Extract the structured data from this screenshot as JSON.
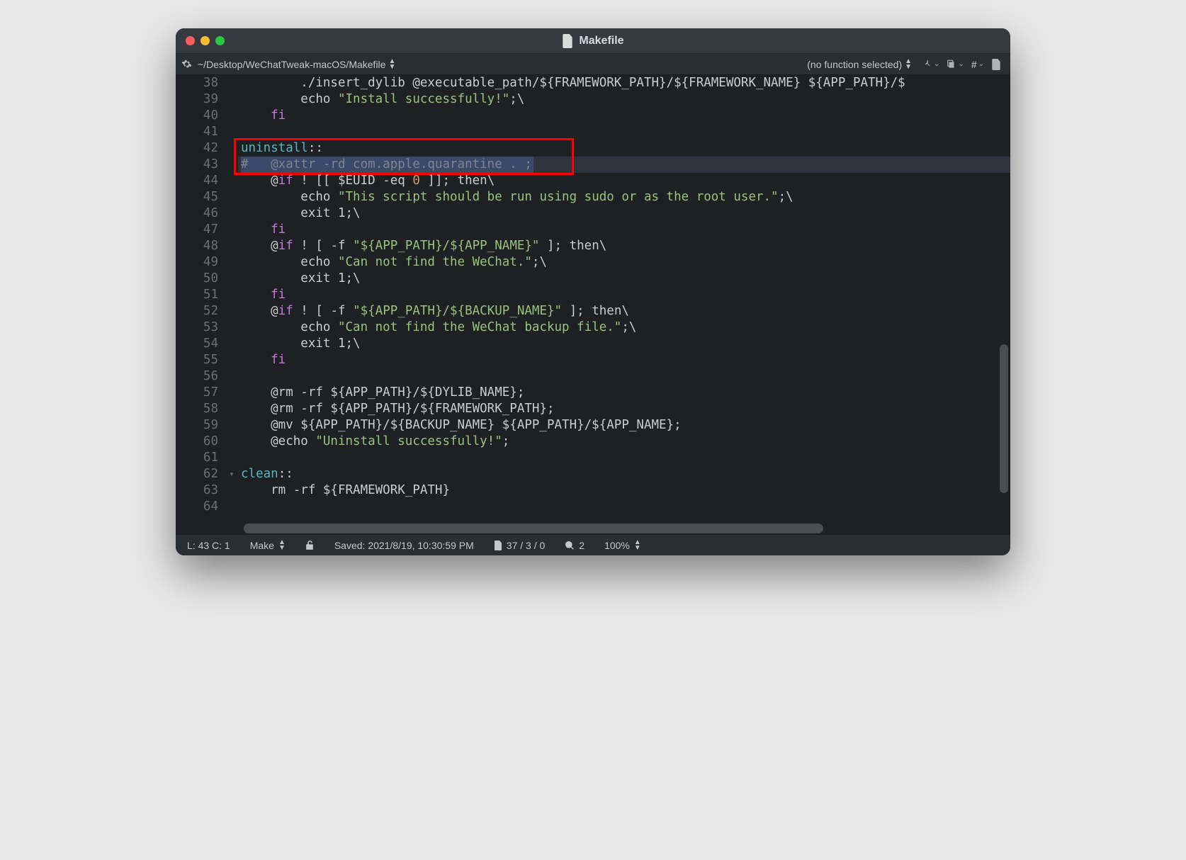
{
  "window": {
    "title": "Makefile"
  },
  "toolbar": {
    "path": "~/Desktop/WeChatTweak-macOS/Makefile",
    "func": "(no function selected)"
  },
  "gutter": {
    "start": 38,
    "end": 64,
    "fold_at": 62
  },
  "code": {
    "lines": [
      {
        "n": 38,
        "segs": [
          {
            "c": "k-text",
            "t": "        ./insert_dylib @executable_path/${FRAMEWORK_PATH}/${FRAMEWORK_NAME} ${APP_PATH}/$"
          }
        ]
      },
      {
        "n": 39,
        "segs": [
          {
            "c": "k-text",
            "t": "        echo "
          },
          {
            "c": "k-str",
            "t": "\"Install successfully!\""
          },
          {
            "c": "k-text",
            "t": ";\\"
          }
        ]
      },
      {
        "n": 40,
        "segs": [
          {
            "c": "k-kw",
            "t": "    fi"
          }
        ]
      },
      {
        "n": 41,
        "segs": []
      },
      {
        "n": 42,
        "segs": [
          {
            "c": "k-target",
            "t": "uninstall"
          },
          {
            "c": "k-text",
            "t": "::"
          }
        ]
      },
      {
        "n": 43,
        "current": true,
        "segs": [
          {
            "c": "k-com",
            "t": "#   @xattr -rd com.apple.quarantine . ;"
          }
        ],
        "selEnd": 39
      },
      {
        "n": 44,
        "segs": [
          {
            "c": "k-text",
            "t": "    @"
          },
          {
            "c": "k-kw",
            "t": "if"
          },
          {
            "c": "k-text",
            "t": " ! [[ $EUID -eq "
          },
          {
            "c": "k-num",
            "t": "0"
          },
          {
            "c": "k-text",
            "t": " ]]; then\\"
          }
        ]
      },
      {
        "n": 45,
        "segs": [
          {
            "c": "k-text",
            "t": "        echo "
          },
          {
            "c": "k-str",
            "t": "\"This script should be run using sudo or as the root user.\""
          },
          {
            "c": "k-text",
            "t": ";\\"
          }
        ]
      },
      {
        "n": 46,
        "segs": [
          {
            "c": "k-text",
            "t": "        exit 1;\\"
          }
        ]
      },
      {
        "n": 47,
        "segs": [
          {
            "c": "k-kw",
            "t": "    fi"
          }
        ]
      },
      {
        "n": 48,
        "segs": [
          {
            "c": "k-text",
            "t": "    @"
          },
          {
            "c": "k-kw",
            "t": "if"
          },
          {
            "c": "k-text",
            "t": " ! [ -f "
          },
          {
            "c": "k-str",
            "t": "\"${APP_PATH}/${APP_NAME}\""
          },
          {
            "c": "k-text",
            "t": " ]; then\\"
          }
        ]
      },
      {
        "n": 49,
        "segs": [
          {
            "c": "k-text",
            "t": "        echo "
          },
          {
            "c": "k-str",
            "t": "\"Can not find the WeChat.\""
          },
          {
            "c": "k-text",
            "t": ";\\"
          }
        ]
      },
      {
        "n": 50,
        "segs": [
          {
            "c": "k-text",
            "t": "        exit 1;\\"
          }
        ]
      },
      {
        "n": 51,
        "segs": [
          {
            "c": "k-kw",
            "t": "    fi"
          }
        ]
      },
      {
        "n": 52,
        "segs": [
          {
            "c": "k-text",
            "t": "    @"
          },
          {
            "c": "k-kw",
            "t": "if"
          },
          {
            "c": "k-text",
            "t": " ! [ -f "
          },
          {
            "c": "k-str",
            "t": "\"${APP_PATH}/${BACKUP_NAME}\""
          },
          {
            "c": "k-text",
            "t": " ]; then\\"
          }
        ]
      },
      {
        "n": 53,
        "segs": [
          {
            "c": "k-text",
            "t": "        echo "
          },
          {
            "c": "k-str",
            "t": "\"Can not find the WeChat backup file.\""
          },
          {
            "c": "k-text",
            "t": ";\\"
          }
        ]
      },
      {
        "n": 54,
        "segs": [
          {
            "c": "k-text",
            "t": "        exit 1;\\"
          }
        ]
      },
      {
        "n": 55,
        "segs": [
          {
            "c": "k-kw",
            "t": "    fi"
          }
        ]
      },
      {
        "n": 56,
        "segs": []
      },
      {
        "n": 57,
        "segs": [
          {
            "c": "k-text",
            "t": "    @rm -rf ${APP_PATH}/${DYLIB_NAME};"
          }
        ]
      },
      {
        "n": 58,
        "segs": [
          {
            "c": "k-text",
            "t": "    @rm -rf ${APP_PATH}/${FRAMEWORK_PATH};"
          }
        ]
      },
      {
        "n": 59,
        "segs": [
          {
            "c": "k-text",
            "t": "    @mv ${APP_PATH}/${BACKUP_NAME} ${APP_PATH}/${APP_NAME};"
          }
        ]
      },
      {
        "n": 60,
        "segs": [
          {
            "c": "k-text",
            "t": "    @echo "
          },
          {
            "c": "k-str",
            "t": "\"Uninstall successfully!\""
          },
          {
            "c": "k-text",
            "t": ";"
          }
        ]
      },
      {
        "n": 61,
        "segs": []
      },
      {
        "n": 62,
        "segs": [
          {
            "c": "k-target",
            "t": "clean"
          },
          {
            "c": "k-text",
            "t": "::"
          }
        ],
        "fold": true
      },
      {
        "n": 63,
        "segs": [
          {
            "c": "k-text",
            "t": "    rm -rf ${FRAMEWORK_PATH}"
          }
        ]
      },
      {
        "n": 64,
        "segs": []
      }
    ]
  },
  "status": {
    "cursor": "L: 43 C: 1",
    "syntax": "Make",
    "saved": "Saved: 2021/8/19, 10:30:59 PM",
    "symbols": "37 / 3 / 0",
    "search": "2",
    "zoom": "100%"
  }
}
